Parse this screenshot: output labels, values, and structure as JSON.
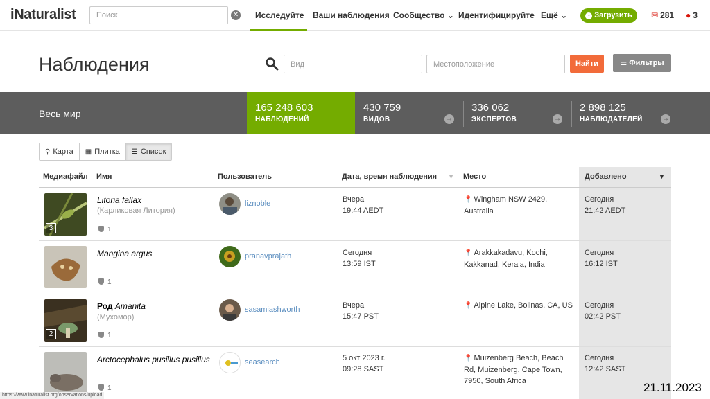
{
  "nav": {
    "logo": "iNaturalist",
    "search_placeholder": "Поиск",
    "links": [
      "Исследуйте",
      "Ваши наблюдения",
      "Сообщество",
      "Идентифицируйте",
      "Ещё"
    ],
    "upload_label": "Загрузить",
    "messages_count": "281",
    "notifications_count": "3"
  },
  "header": {
    "title": "Наблюдения",
    "species_placeholder": "Вид",
    "location_placeholder": "Местоположение",
    "find_label": "Найти",
    "filters_label": "Фильтры"
  },
  "stats": {
    "scope": "Весь мир",
    "items": [
      {
        "value": "165 248 603",
        "label": "НАБЛЮДЕНИЙ"
      },
      {
        "value": "430 759",
        "label": "ВИДОВ"
      },
      {
        "value": "336 062",
        "label": "ЭКСПЕРТОВ"
      },
      {
        "value": "2 898 125",
        "label": "НАБЛЮДАТЕЛЕЙ"
      }
    ]
  },
  "view_tabs": [
    "Карта",
    "Плитка",
    "Список"
  ],
  "table": {
    "headers": [
      "Медиафайл",
      "Имя",
      "Пользователь",
      "Дата, время наблюдения",
      "Место",
      "Добавлено"
    ],
    "rows": [
      {
        "rank": "",
        "taxon": "Litoria fallax",
        "common": "(Карликовая Литория)",
        "photo_count": "3",
        "ids": "1",
        "user": "liznoble",
        "obs_day": "Вчера",
        "obs_time": "19:44 AEDT",
        "place": "Wingham NSW 2429, Australia",
        "added_day": "Сегодня",
        "added_time": "21:42 AEDT"
      },
      {
        "rank": "",
        "taxon": "Mangina argus",
        "common": "",
        "photo_count": "",
        "ids": "1",
        "user": "pranavprajath",
        "obs_day": "Сегодня",
        "obs_time": "13:59 IST",
        "place": "Arakkakadavu, Kochi, Kakkanad, Kerala, India",
        "added_day": "Сегодня",
        "added_time": "16:12 IST"
      },
      {
        "rank": "Род",
        "taxon": "Amanita",
        "common": "(Мухомор)",
        "photo_count": "2",
        "ids": "1",
        "user": "sasamiashworth",
        "obs_day": "Вчера",
        "obs_time": "15:47 PST",
        "place": "Alpine Lake, Bolinas, CA, US",
        "added_day": "Сегодня",
        "added_time": "02:42 PST"
      },
      {
        "rank": "",
        "taxon": "Arctocephalus pusillus pusillus",
        "common": "",
        "photo_count": "",
        "ids": "1",
        "user": "seasearch",
        "obs_day": "5 окт 2023 г.",
        "obs_time": "09:28 SAST",
        "place": "Muizenberg Beach, Beach Rd, Muizenberg, Cape Town, 7950, South Africa",
        "added_day": "Сегодня",
        "added_time": "12:42 SAST"
      }
    ]
  },
  "status_url": "https://www.inaturalist.org/observations/upload",
  "date_stamp": "21.11.2023",
  "colors": {
    "brand": "#74ac00",
    "find_button": "#f26b3a",
    "stats_bar": "#5d5d5d",
    "link": "#5a8dbf"
  }
}
